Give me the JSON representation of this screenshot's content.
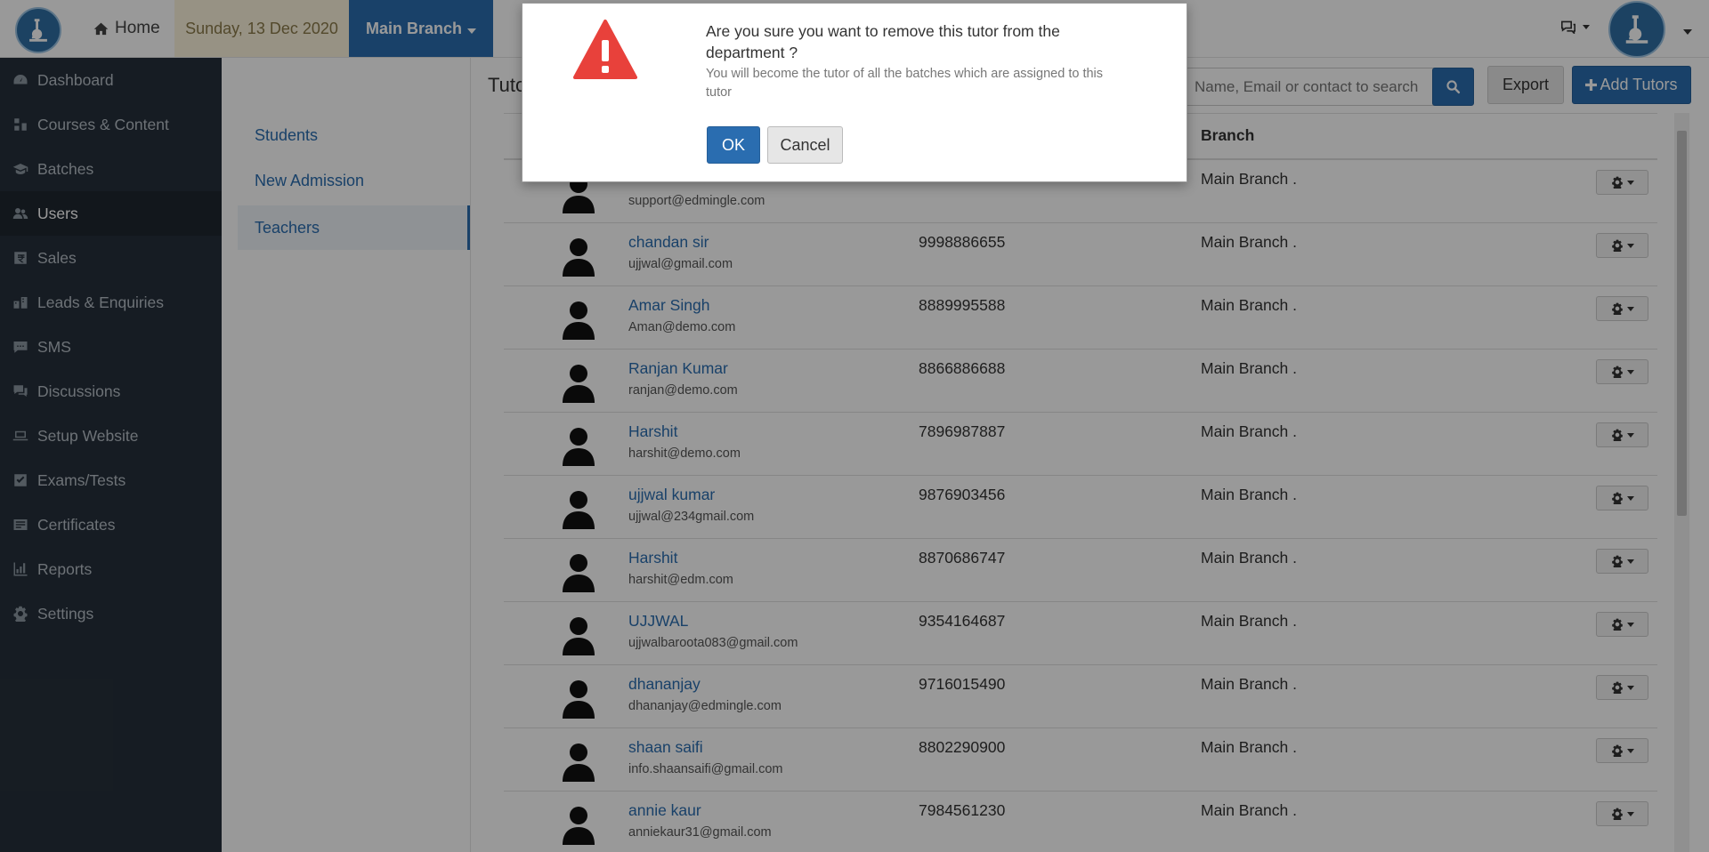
{
  "topbar": {
    "home_label": "Home",
    "date": "Sunday, 13 Dec 2020",
    "branch": "Main Branch"
  },
  "sidebar": {
    "items": [
      {
        "label": "Dashboard",
        "icon": "dashboard-icon"
      },
      {
        "label": "Courses & Content",
        "icon": "courses-icon"
      },
      {
        "label": "Batches",
        "icon": "graduation-cap-icon"
      },
      {
        "label": "Users",
        "icon": "users-icon"
      },
      {
        "label": "Sales",
        "icon": "rupee-icon"
      },
      {
        "label": "Leads & Enquiries",
        "icon": "leads-icon"
      },
      {
        "label": "SMS",
        "icon": "sms-icon"
      },
      {
        "label": "Discussions",
        "icon": "comments-icon"
      },
      {
        "label": "Setup Website",
        "icon": "laptop-icon"
      },
      {
        "label": "Exams/Tests",
        "icon": "checkbox-icon"
      },
      {
        "label": "Certificates",
        "icon": "certificate-icon"
      },
      {
        "label": "Reports",
        "icon": "bar-chart-icon"
      },
      {
        "label": "Settings",
        "icon": "gear-icon"
      }
    ]
  },
  "subnav": {
    "items": [
      "Students",
      "New Admission",
      "Teachers"
    ]
  },
  "main": {
    "title": "Tuto",
    "search_placeholder": "Name, Email or contact to search",
    "export_label": "Export",
    "add_label": "Add Tutors",
    "branch_header": "Branch"
  },
  "rows": [
    {
      "name": "",
      "email": "support@edmingle.com",
      "phone": "",
      "branch": "Main Branch ."
    },
    {
      "name": "chandan sir",
      "email": "ujjwal@gmail.com",
      "phone": "9998886655",
      "branch": "Main Branch ."
    },
    {
      "name": "Amar Singh",
      "email": "Aman@demo.com",
      "phone": "8889995588",
      "branch": "Main Branch ."
    },
    {
      "name": "Ranjan Kumar",
      "email": "ranjan@demo.com",
      "phone": "8866886688",
      "branch": "Main Branch ."
    },
    {
      "name": "Harshit",
      "email": "harshit@demo.com",
      "phone": "7896987887",
      "branch": "Main Branch ."
    },
    {
      "name": "ujjwal kumar",
      "email": "ujjwal@234gmail.com",
      "phone": "9876903456",
      "branch": "Main Branch ."
    },
    {
      "name": "Harshit",
      "email": "harshit@edm.com",
      "phone": "8870686747",
      "branch": "Main Branch ."
    },
    {
      "name": "UJJWAL",
      "email": "ujjwalbaroota083@gmail.com",
      "phone": "9354164687",
      "branch": "Main Branch ."
    },
    {
      "name": "dhananjay",
      "email": "dhananjay@edmingle.com",
      "phone": "9716015490",
      "branch": "Main Branch ."
    },
    {
      "name": "shaan saifi",
      "email": "info.shaansaifi@gmail.com",
      "phone": "8802290900",
      "branch": "Main Branch ."
    },
    {
      "name": "annie kaur",
      "email": "anniekaur31@gmail.com",
      "phone": "7984561230",
      "branch": "Main Branch ."
    }
  ],
  "modal": {
    "title": "Are you sure you want to remove this tutor from the department ?",
    "text": "You will become the tutor of all the batches which are assigned to this tutor",
    "ok_label": "OK",
    "cancel_label": "Cancel"
  },
  "colors": {
    "primary": "#2a6db0",
    "sidebar": "#26303b",
    "warning": "#e8413b"
  }
}
